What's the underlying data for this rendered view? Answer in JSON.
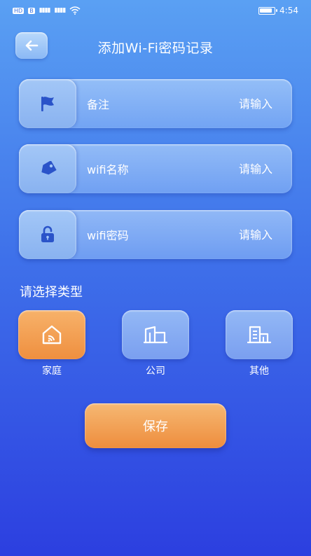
{
  "status_bar": {
    "left_chip": "HD",
    "left_chip2": "B",
    "signal1": "4G",
    "signal2": "4G",
    "time": "4:54"
  },
  "header": {
    "title": "添加Wi-Fi密码记录",
    "back_icon": "arrow-left-icon"
  },
  "fields": [
    {
      "label": "备注",
      "placeholder": "请输入",
      "icon": "flag-icon"
    },
    {
      "label": "wifi名称",
      "placeholder": "请输入",
      "icon": "tag-icon"
    },
    {
      "label": "wifi密码",
      "placeholder": "请输入",
      "icon": "lock-icon"
    }
  ],
  "type_section": {
    "title": "请选择类型",
    "types": [
      {
        "label": "家庭",
        "icon": "home-wifi-icon",
        "selected": true
      },
      {
        "label": "公司",
        "icon": "company-building-icon",
        "selected": false
      },
      {
        "label": "其他",
        "icon": "other-building-icon",
        "selected": false
      }
    ]
  },
  "save_label": "保存",
  "colors": {
    "accent_orange": "#ef8f3f",
    "icon_blue": "#2a53c9",
    "bg_top": "#5aa0f3",
    "bg_bottom": "#2c3fe0"
  }
}
